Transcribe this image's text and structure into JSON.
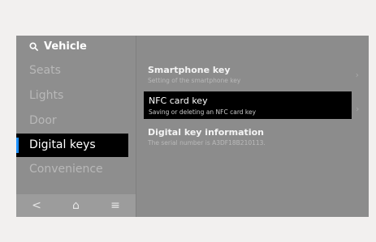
{
  "search": {
    "label": "Vehicle",
    "icon": "search-icon"
  },
  "sidebar": {
    "items": [
      {
        "label": "Seats"
      },
      {
        "label": "Lights"
      },
      {
        "label": "Door"
      },
      {
        "label": "Digital keys"
      },
      {
        "label": "Convenience"
      }
    ],
    "active_index": 3,
    "accent_color": "#1e90ff"
  },
  "bottom_bar": {
    "back_icon": "<",
    "home_icon": "⌂",
    "menu_icon": "≡"
  },
  "main": {
    "rows": [
      {
        "title": "Smartphone key",
        "subtitle": "Setting of the smartphone key"
      },
      {
        "title": "NFC card key",
        "subtitle": "Saving or deleting an NFC card key"
      },
      {
        "title": "Digital key information",
        "subtitle": "The serial number is A3DF18B210113."
      }
    ],
    "chevron": "›"
  }
}
